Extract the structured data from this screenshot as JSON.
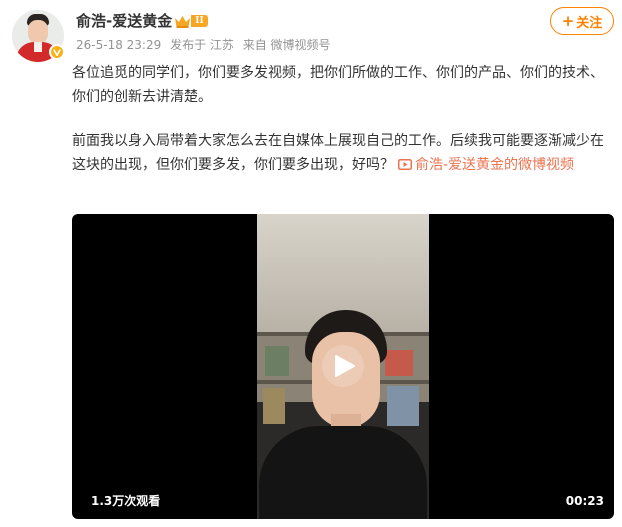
{
  "post": {
    "author": {
      "name": "俞浩-爱送黄金",
      "level_badge": "II",
      "verified_icon": "verified-v-icon",
      "crown_icon": "member-crown-icon"
    },
    "meta": {
      "timestamp": "26-5-18 23:29",
      "location": "发布于 江苏",
      "source": "来自 微博视频号"
    },
    "follow_label": "关注",
    "text": {
      "paragraph1": "各位追觅的同学们，你们要多发视频，把你们所做的工作、你们的产品、你们的技术、你们的创新去讲清楚。",
      "paragraph2": "前面我以身入局带着大家怎么去在自媒体上展现自己的工作。后续我可能要逐渐减少在这块的出现，但你们要多发，你们要多出现，好吗？",
      "video_link": "俞浩-爱送黄金的微博视频"
    },
    "video": {
      "view_count": "1.3万次观看",
      "duration": "00:23"
    }
  },
  "colors": {
    "accent": "#ff8200",
    "link": "#eb7350",
    "meta": "#939393",
    "text": "#333333"
  }
}
